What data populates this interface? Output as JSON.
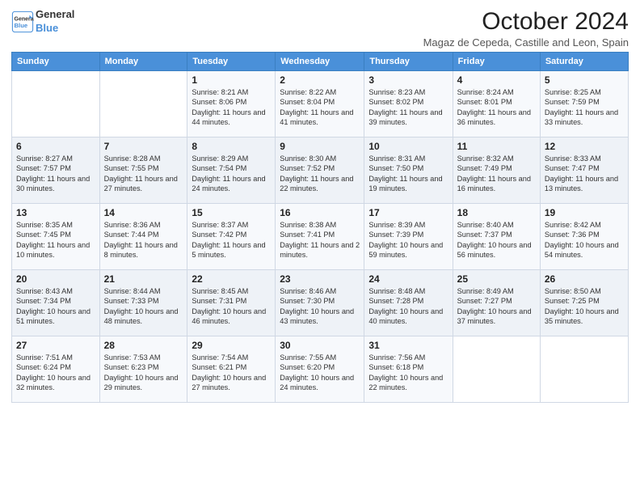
{
  "header": {
    "logo_line1": "General",
    "logo_line2": "Blue",
    "title": "October 2024",
    "subtitle": "Magaz de Cepeda, Castille and Leon, Spain"
  },
  "weekdays": [
    "Sunday",
    "Monday",
    "Tuesday",
    "Wednesday",
    "Thursday",
    "Friday",
    "Saturday"
  ],
  "weeks": [
    [
      {
        "day": "",
        "detail": ""
      },
      {
        "day": "",
        "detail": ""
      },
      {
        "day": "1",
        "detail": "Sunrise: 8:21 AM\nSunset: 8:06 PM\nDaylight: 11 hours and 44 minutes."
      },
      {
        "day": "2",
        "detail": "Sunrise: 8:22 AM\nSunset: 8:04 PM\nDaylight: 11 hours and 41 minutes."
      },
      {
        "day": "3",
        "detail": "Sunrise: 8:23 AM\nSunset: 8:02 PM\nDaylight: 11 hours and 39 minutes."
      },
      {
        "day": "4",
        "detail": "Sunrise: 8:24 AM\nSunset: 8:01 PM\nDaylight: 11 hours and 36 minutes."
      },
      {
        "day": "5",
        "detail": "Sunrise: 8:25 AM\nSunset: 7:59 PM\nDaylight: 11 hours and 33 minutes."
      }
    ],
    [
      {
        "day": "6",
        "detail": "Sunrise: 8:27 AM\nSunset: 7:57 PM\nDaylight: 11 hours and 30 minutes."
      },
      {
        "day": "7",
        "detail": "Sunrise: 8:28 AM\nSunset: 7:55 PM\nDaylight: 11 hours and 27 minutes."
      },
      {
        "day": "8",
        "detail": "Sunrise: 8:29 AM\nSunset: 7:54 PM\nDaylight: 11 hours and 24 minutes."
      },
      {
        "day": "9",
        "detail": "Sunrise: 8:30 AM\nSunset: 7:52 PM\nDaylight: 11 hours and 22 minutes."
      },
      {
        "day": "10",
        "detail": "Sunrise: 8:31 AM\nSunset: 7:50 PM\nDaylight: 11 hours and 19 minutes."
      },
      {
        "day": "11",
        "detail": "Sunrise: 8:32 AM\nSunset: 7:49 PM\nDaylight: 11 hours and 16 minutes."
      },
      {
        "day": "12",
        "detail": "Sunrise: 8:33 AM\nSunset: 7:47 PM\nDaylight: 11 hours and 13 minutes."
      }
    ],
    [
      {
        "day": "13",
        "detail": "Sunrise: 8:35 AM\nSunset: 7:45 PM\nDaylight: 11 hours and 10 minutes."
      },
      {
        "day": "14",
        "detail": "Sunrise: 8:36 AM\nSunset: 7:44 PM\nDaylight: 11 hours and 8 minutes."
      },
      {
        "day": "15",
        "detail": "Sunrise: 8:37 AM\nSunset: 7:42 PM\nDaylight: 11 hours and 5 minutes."
      },
      {
        "day": "16",
        "detail": "Sunrise: 8:38 AM\nSunset: 7:41 PM\nDaylight: 11 hours and 2 minutes."
      },
      {
        "day": "17",
        "detail": "Sunrise: 8:39 AM\nSunset: 7:39 PM\nDaylight: 10 hours and 59 minutes."
      },
      {
        "day": "18",
        "detail": "Sunrise: 8:40 AM\nSunset: 7:37 PM\nDaylight: 10 hours and 56 minutes."
      },
      {
        "day": "19",
        "detail": "Sunrise: 8:42 AM\nSunset: 7:36 PM\nDaylight: 10 hours and 54 minutes."
      }
    ],
    [
      {
        "day": "20",
        "detail": "Sunrise: 8:43 AM\nSunset: 7:34 PM\nDaylight: 10 hours and 51 minutes."
      },
      {
        "day": "21",
        "detail": "Sunrise: 8:44 AM\nSunset: 7:33 PM\nDaylight: 10 hours and 48 minutes."
      },
      {
        "day": "22",
        "detail": "Sunrise: 8:45 AM\nSunset: 7:31 PM\nDaylight: 10 hours and 46 minutes."
      },
      {
        "day": "23",
        "detail": "Sunrise: 8:46 AM\nSunset: 7:30 PM\nDaylight: 10 hours and 43 minutes."
      },
      {
        "day": "24",
        "detail": "Sunrise: 8:48 AM\nSunset: 7:28 PM\nDaylight: 10 hours and 40 minutes."
      },
      {
        "day": "25",
        "detail": "Sunrise: 8:49 AM\nSunset: 7:27 PM\nDaylight: 10 hours and 37 minutes."
      },
      {
        "day": "26",
        "detail": "Sunrise: 8:50 AM\nSunset: 7:25 PM\nDaylight: 10 hours and 35 minutes."
      }
    ],
    [
      {
        "day": "27",
        "detail": "Sunrise: 7:51 AM\nSunset: 6:24 PM\nDaylight: 10 hours and 32 minutes."
      },
      {
        "day": "28",
        "detail": "Sunrise: 7:53 AM\nSunset: 6:23 PM\nDaylight: 10 hours and 29 minutes."
      },
      {
        "day": "29",
        "detail": "Sunrise: 7:54 AM\nSunset: 6:21 PM\nDaylight: 10 hours and 27 minutes."
      },
      {
        "day": "30",
        "detail": "Sunrise: 7:55 AM\nSunset: 6:20 PM\nDaylight: 10 hours and 24 minutes."
      },
      {
        "day": "31",
        "detail": "Sunrise: 7:56 AM\nSunset: 6:18 PM\nDaylight: 10 hours and 22 minutes."
      },
      {
        "day": "",
        "detail": ""
      },
      {
        "day": "",
        "detail": ""
      }
    ]
  ]
}
